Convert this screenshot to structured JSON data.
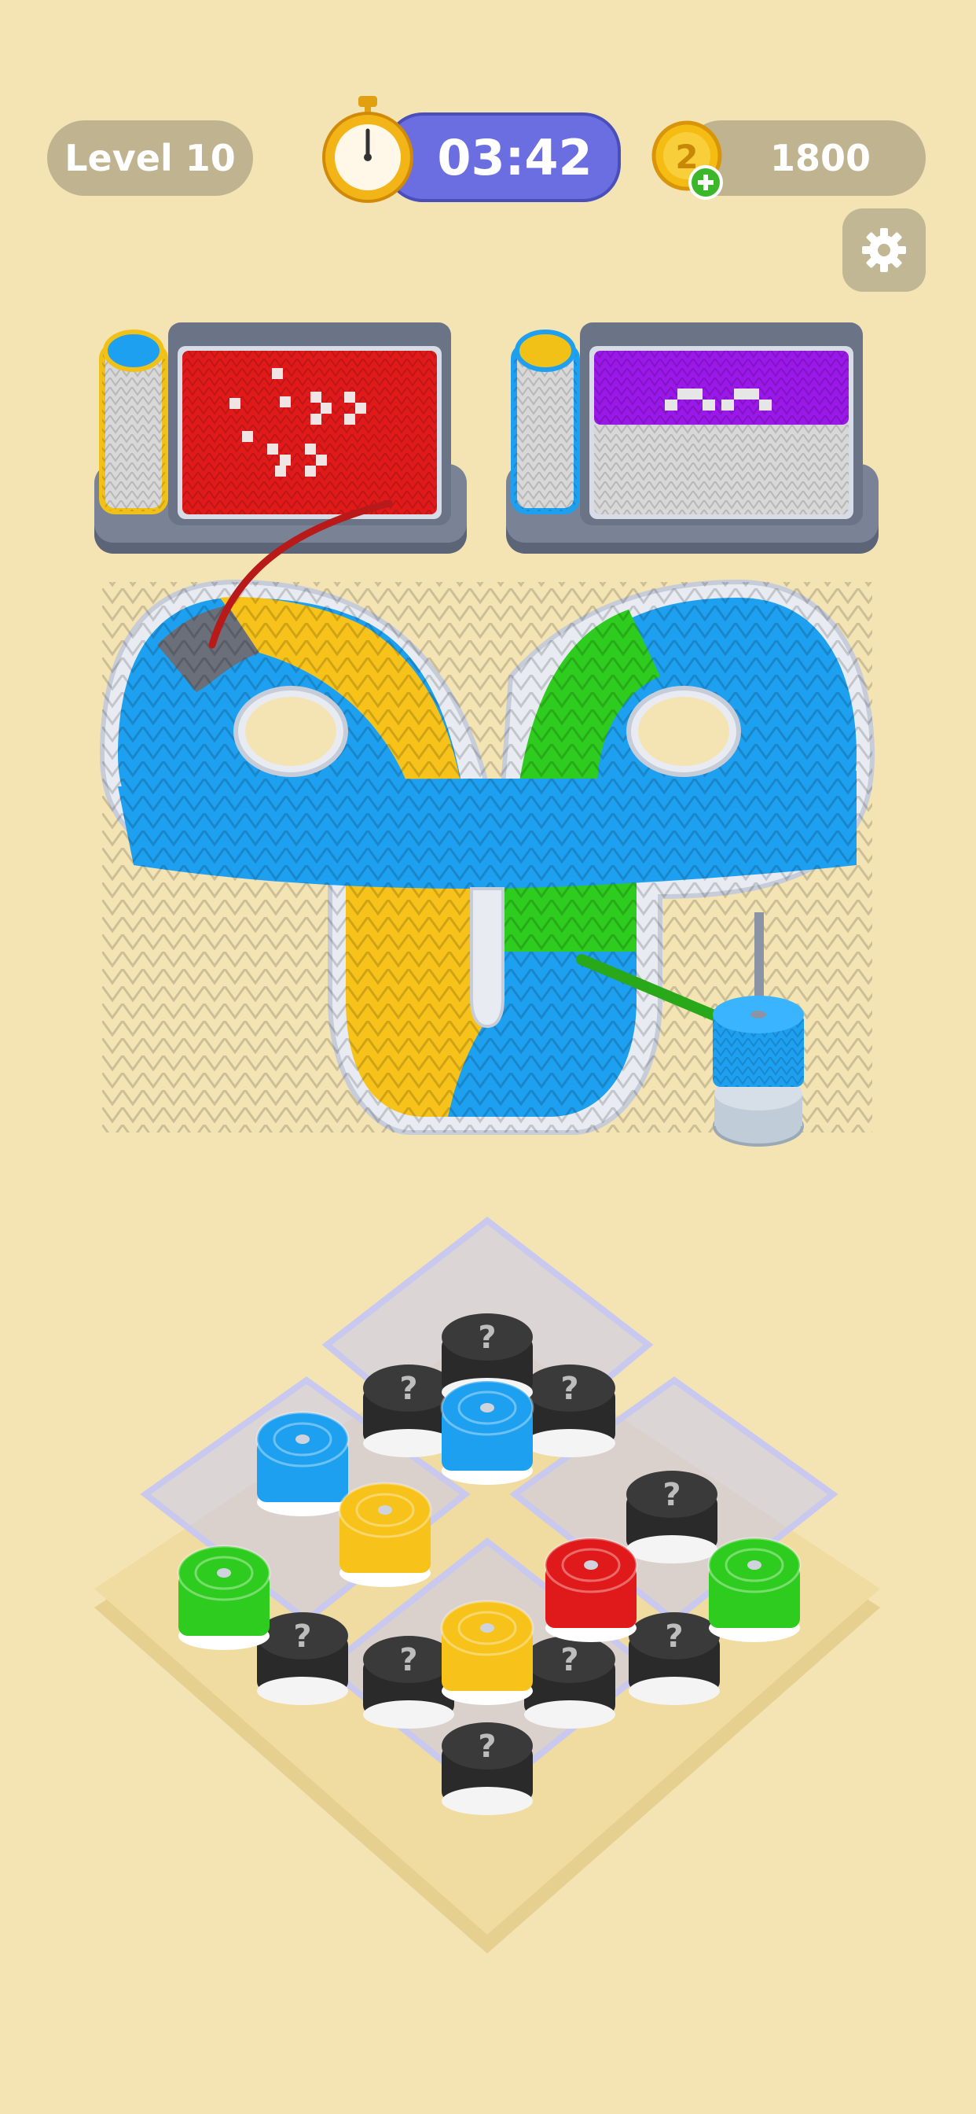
{
  "hud": {
    "level_label": "Level 10",
    "timer": "03:42",
    "coins": "1800"
  },
  "icons": {
    "timer": "stopwatch-icon",
    "coin": "coin-plus-icon",
    "settings": "gear-icon",
    "mystery": "question-mark-icon"
  },
  "colors": {
    "background": "#f4e4b4",
    "yarn_blue": "#1ea0f0",
    "yarn_yellow": "#f7c21a",
    "yarn_green": "#2ecc1e",
    "yarn_red": "#e01a1a",
    "yarn_purple": "#9a18e8",
    "yarn_black": "#2a2a2a",
    "timer_pill": "#6a6ee0",
    "hud_pill": "#bfb390"
  },
  "looms": [
    {
      "spool_color": "yarn_blue",
      "rim_color": "yarn_yellow",
      "canvas_color": "yarn_red"
    },
    {
      "spool_color": "yarn_yellow",
      "rim_color": "yarn_blue",
      "canvas_color": "yarn_purple"
    }
  ],
  "queue_spool": {
    "color": "yarn_blue"
  },
  "board": {
    "visible_spools": [
      "yarn_blue",
      "yarn_yellow",
      "yarn_green",
      "yarn_blue",
      "yarn_yellow",
      "yarn_red",
      "yarn_green"
    ],
    "mystery_stacks": 9
  }
}
